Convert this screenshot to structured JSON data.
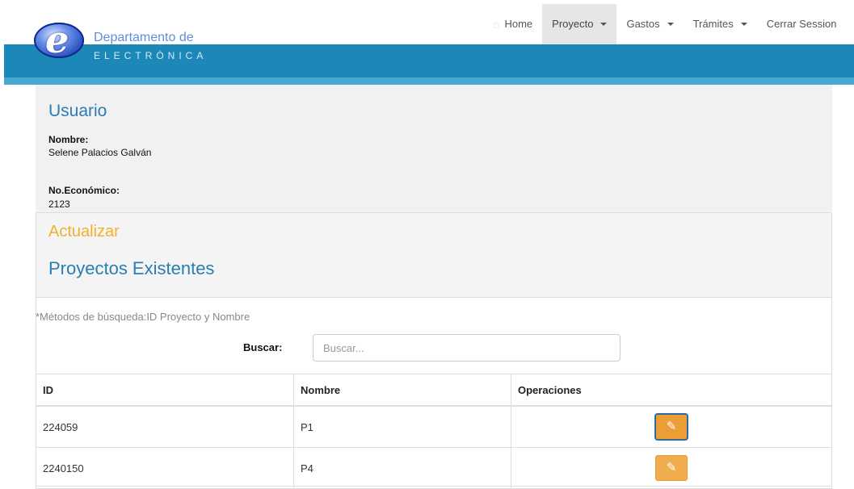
{
  "logo": {
    "letter": "e",
    "line1": "Departamento de",
    "line2": "ELECTRÓNICA"
  },
  "nav": {
    "home": "Home",
    "proyecto": "Proyecto",
    "gastos": "Gastos",
    "tramites": "Trámites",
    "logout": "Cerrar Session"
  },
  "user": {
    "title": "Usuario",
    "name_label": "Nombre:",
    "name_value": "Selene Palacios Galván",
    "econ_label": "No.Económico:",
    "econ_value": "2123"
  },
  "projects": {
    "update_link": "Actualizar",
    "title": "Proyectos Existentes",
    "hint": "*Métodos de búsqueda:ID Proyecto y Nombre",
    "search_label": "Buscar:",
    "search_placeholder": "Buscar...",
    "search_value": ""
  },
  "table": {
    "headers": {
      "id": "ID",
      "nombre": "Nombre",
      "operaciones": "Operaciones"
    },
    "rows": [
      {
        "id": "224059",
        "nombre": "P1"
      },
      {
        "id": "2240150",
        "nombre": "P4"
      }
    ]
  },
  "icons": {
    "home": "home-icon",
    "edit": "pencil-icon",
    "caret": "caret-down-icon"
  },
  "colors": {
    "header_bar": "#1c88b7",
    "title_blue": "#2a7db3",
    "update_orange": "#f1b12c",
    "edit_button": "#f0ad4e"
  }
}
